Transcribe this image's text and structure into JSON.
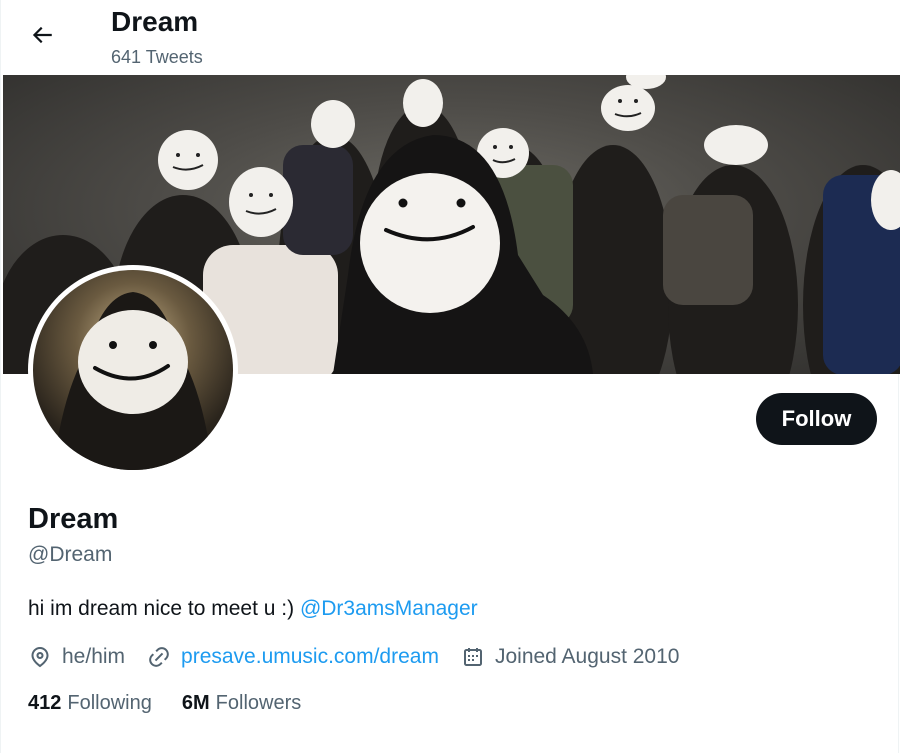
{
  "header": {
    "title": "Dream",
    "tweet_count": "641 Tweets"
  },
  "profile": {
    "name": "Dream",
    "handle": "@Dream",
    "bio_text": "hi im dream nice to meet u :) ",
    "bio_mention": "@Dr3amsManager",
    "pronouns": "he/him",
    "website": "presave.umusic.com/dream",
    "joined": "Joined August 2010",
    "following_count": "412",
    "following_label": "Following",
    "followers_count": "6M",
    "followers_label": "Followers"
  },
  "actions": {
    "follow_label": "Follow"
  },
  "icons": {
    "back": "arrow-left-icon",
    "location": "location-pin-icon",
    "link": "link-icon",
    "calendar": "calendar-icon"
  },
  "colors": {
    "accent": "#1d9bf0",
    "text": "#0f1419",
    "secondary": "#536471",
    "button": "#0f1419"
  }
}
